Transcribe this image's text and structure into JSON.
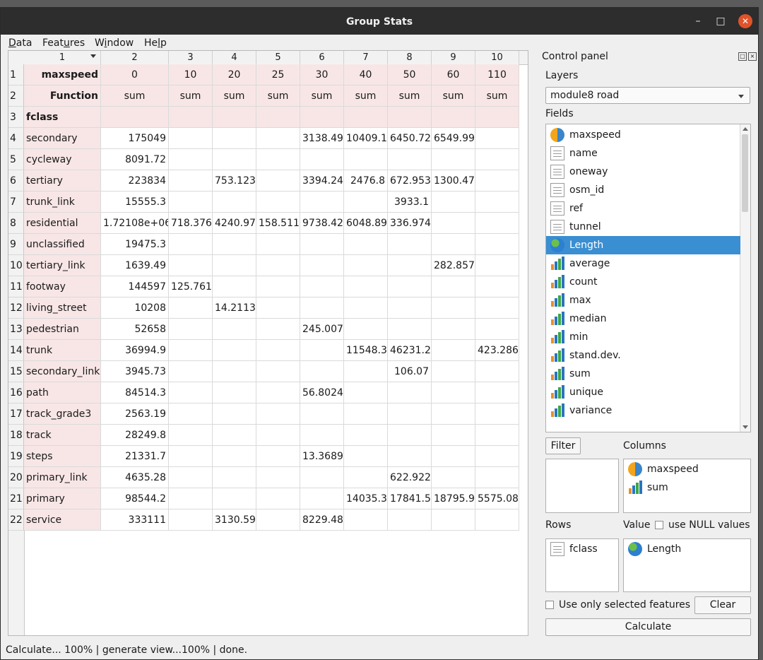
{
  "window": {
    "title": "Group Stats"
  },
  "menu": [
    {
      "pre": "",
      "u": "D",
      "post": "ata"
    },
    {
      "pre": "Feat",
      "u": "u",
      "post": "res"
    },
    {
      "pre": "W",
      "u": "i",
      "post": "ndow"
    },
    {
      "pre": "He",
      "u": "l",
      "post": "p"
    }
  ],
  "grid": {
    "column_headers": [
      "1",
      "2",
      "3",
      "4",
      "5",
      "6",
      "7",
      "8",
      "9",
      "10"
    ],
    "rows": [
      {
        "n": "1",
        "cells": [
          "maxspeed",
          "0",
          "10",
          "20",
          "25",
          "30",
          "40",
          "50",
          "60",
          "110"
        ]
      },
      {
        "n": "2",
        "cells": [
          "Function",
          "sum",
          "sum",
          "sum",
          "sum",
          "sum",
          "sum",
          "sum",
          "sum",
          "sum"
        ]
      },
      {
        "n": "3",
        "cells": [
          "fclass",
          "",
          "",
          "",
          "",
          "",
          "",
          "",
          "",
          ""
        ]
      },
      {
        "n": "4",
        "cells": [
          "secondary",
          "175049",
          "",
          "",
          "",
          "3138.49",
          "10409.1",
          "6450.72",
          "6549.99",
          ""
        ]
      },
      {
        "n": "5",
        "cells": [
          "cycleway",
          "8091.72",
          "",
          "",
          "",
          "",
          "",
          "",
          "",
          ""
        ]
      },
      {
        "n": "6",
        "cells": [
          "tertiary",
          "223834",
          "",
          "753.123",
          "",
          "3394.24",
          "2476.8",
          "672.953",
          "1300.47",
          ""
        ]
      },
      {
        "n": "7",
        "cells": [
          "trunk_link",
          "15555.3",
          "",
          "",
          "",
          "",
          "",
          "3933.1",
          "",
          ""
        ]
      },
      {
        "n": "8",
        "cells": [
          "residential",
          "1.72108e+06",
          "718.376",
          "4240.97",
          "158.511",
          "9738.42",
          "6048.89",
          "336.974",
          "",
          ""
        ]
      },
      {
        "n": "9",
        "cells": [
          "unclassified",
          "19475.3",
          "",
          "",
          "",
          "",
          "",
          "",
          "",
          ""
        ]
      },
      {
        "n": "10",
        "cells": [
          "tertiary_link",
          "1639.49",
          "",
          "",
          "",
          "",
          "",
          "",
          "282.857",
          ""
        ]
      },
      {
        "n": "11",
        "cells": [
          "footway",
          "144597",
          "125.761",
          "",
          "",
          "",
          "",
          "",
          "",
          ""
        ]
      },
      {
        "n": "12",
        "cells": [
          "living_street",
          "10208",
          "",
          "14.2113",
          "",
          "",
          "",
          "",
          "",
          ""
        ]
      },
      {
        "n": "13",
        "cells": [
          "pedestrian",
          "52658",
          "",
          "",
          "",
          "245.007",
          "",
          "",
          "",
          ""
        ]
      },
      {
        "n": "14",
        "cells": [
          "trunk",
          "36994.9",
          "",
          "",
          "",
          "",
          "11548.3",
          "46231.2",
          "",
          "423.286"
        ]
      },
      {
        "n": "15",
        "cells": [
          "secondary_link",
          "3945.73",
          "",
          "",
          "",
          "",
          "",
          "106.07",
          "",
          ""
        ]
      },
      {
        "n": "16",
        "cells": [
          "path",
          "84514.3",
          "",
          "",
          "",
          "56.8024",
          "",
          "",
          "",
          ""
        ]
      },
      {
        "n": "17",
        "cells": [
          "track_grade3",
          "2563.19",
          "",
          "",
          "",
          "",
          "",
          "",
          "",
          ""
        ]
      },
      {
        "n": "18",
        "cells": [
          "track",
          "28249.8",
          "",
          "",
          "",
          "",
          "",
          "",
          "",
          ""
        ]
      },
      {
        "n": "19",
        "cells": [
          "steps",
          "21331.7",
          "",
          "",
          "",
          "13.3689",
          "",
          "",
          "",
          ""
        ]
      },
      {
        "n": "20",
        "cells": [
          "primary_link",
          "4635.28",
          "",
          "",
          "",
          "",
          "",
          "622.922",
          "",
          ""
        ]
      },
      {
        "n": "21",
        "cells": [
          "primary",
          "98544.2",
          "",
          "",
          "",
          "",
          "14035.3",
          "17841.5",
          "18795.9",
          "5575.08"
        ]
      },
      {
        "n": "22",
        "cells": [
          "service",
          "333111",
          "",
          "3130.59",
          "",
          "8229.48",
          "",
          "",
          "",
          ""
        ]
      }
    ]
  },
  "control_panel": {
    "title": "Control panel",
    "layers_label": "Layers",
    "layer_value": "module8 road",
    "fields_label": "Fields",
    "fields": [
      {
        "label": "maxspeed",
        "icon": "pie-icon"
      },
      {
        "label": "name",
        "icon": "text-field-icon"
      },
      {
        "label": "oneway",
        "icon": "text-field-icon"
      },
      {
        "label": "osm_id",
        "icon": "text-field-icon"
      },
      {
        "label": "ref",
        "icon": "text-field-icon"
      },
      {
        "label": "tunnel",
        "icon": "text-field-icon"
      },
      {
        "label": "Length",
        "icon": "globe-icon",
        "selected": true
      },
      {
        "label": "average",
        "icon": "bar-chart-icon"
      },
      {
        "label": "count",
        "icon": "bar-chart-icon"
      },
      {
        "label": "max",
        "icon": "bar-chart-icon"
      },
      {
        "label": "median",
        "icon": "bar-chart-icon"
      },
      {
        "label": "min",
        "icon": "bar-chart-icon"
      },
      {
        "label": "stand.dev.",
        "icon": "bar-chart-icon"
      },
      {
        "label": "sum",
        "icon": "bar-chart-icon"
      },
      {
        "label": "unique",
        "icon": "bar-chart-icon"
      },
      {
        "label": "variance",
        "icon": "bar-chart-icon"
      }
    ],
    "filter_label": "Filter",
    "columns_label": "Columns",
    "columns": [
      {
        "label": "maxspeed",
        "icon": "pie-icon"
      },
      {
        "label": "sum",
        "icon": "bar-chart-icon"
      }
    ],
    "rows_label": "Rows",
    "rows": [
      {
        "label": "fclass",
        "icon": "text-field-icon"
      }
    ],
    "value_label": "Value",
    "use_null_label": "use NULL values",
    "values": [
      {
        "label": "Length",
        "icon": "globe-icon"
      }
    ],
    "use_selected_label": "Use only selected features",
    "clear_label": "Clear",
    "calculate_label": "Calculate"
  },
  "status": {
    "text": "Calculate... 100% |  generate view...100% |  done."
  }
}
